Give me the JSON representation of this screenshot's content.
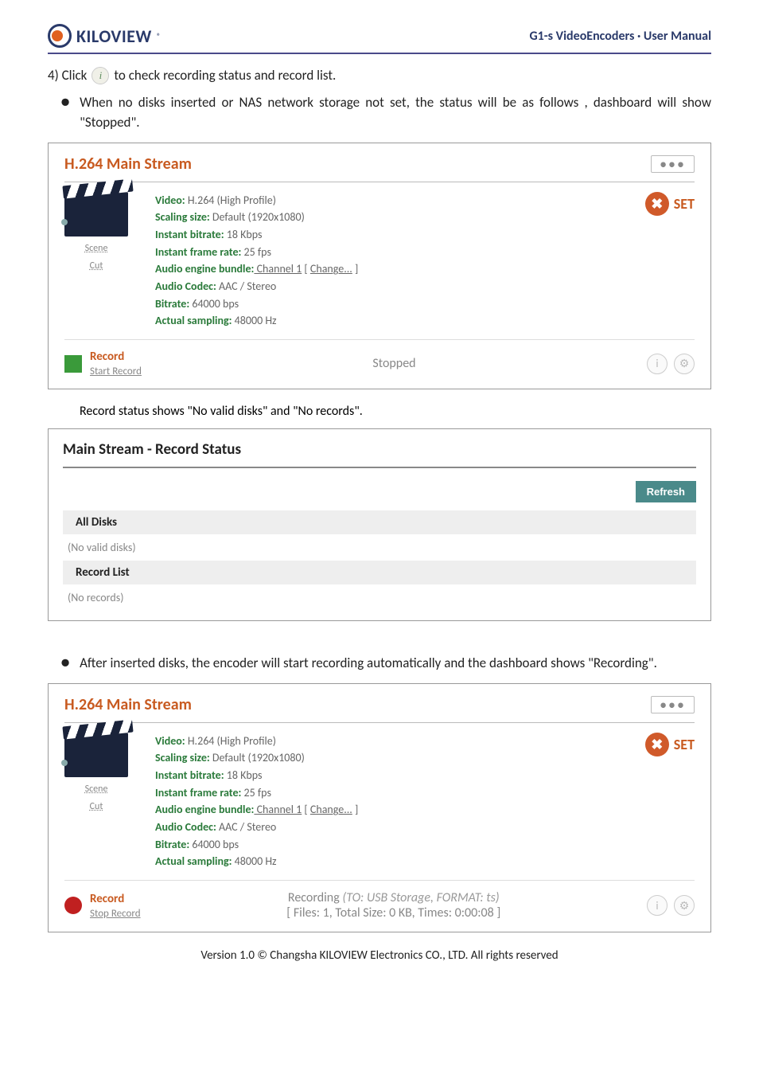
{
  "header": {
    "brand": "KILOVIEW",
    "reg": "®",
    "right": "G1-s VideoEncoders · User Manual"
  },
  "intro": {
    "click_prefix": "4) Click",
    "click_suffix": "to check recording status and record list.",
    "bullet1": "When no disks inserted or NAS network storage not set, the status will be as follows , dashboard will show \"Stopped\"."
  },
  "panel1": {
    "title": "H.264 Main Stream",
    "set": "SET",
    "scene": "Scene",
    "cut": "Cut",
    "info": {
      "video_k": "Video:",
      "video_v": " H.264 (High Profile)",
      "scale_k": "Scaling size:",
      "scale_v": " Default (1920x1080)",
      "ib_k": "Instant bitrate:",
      "ib_v": " 18 Kbps",
      "ifr_k": "Instant frame rate:",
      "ifr_v": " 25 fps",
      "aeb_k": "Audio engine bundle:",
      "aeb_v1": " Channel 1",
      "aeb_v2": " [ ",
      "aeb_link": "Change...",
      "aeb_v3": " ]",
      "ac_k": "Audio Codec:",
      "ac_v": " AAC / Stereo",
      "br_k": "Bitrate:",
      "br_v": " 64000 bps",
      "as_k": "Actual sampling:",
      "as_v": " 48000 Hz"
    },
    "rec": {
      "title": "Record",
      "link": "Start Record",
      "status": "Stopped"
    }
  },
  "caption1": "Record status shows \"No valid disks\" and \"No records\".",
  "status_panel": {
    "title": "Main Stream - Record Status",
    "refresh": "Refresh",
    "all_disks": "All Disks",
    "no_disks": "(No valid disks)",
    "record_list": "Record List",
    "no_records": "(No records)"
  },
  "bullet2": "After inserted disks, the encoder will start recording automatically and the dashboard shows \"Recording\".",
  "panel2": {
    "title": "H.264 Main Stream",
    "set": "SET",
    "scene": "Scene",
    "cut": "Cut",
    "rec": {
      "title": "Record",
      "link": "Stop Record",
      "line1": "Recording ",
      "line1_em": "(TO: USB Storage, FORMAT: ts)",
      "line2": "[ Files: 1, Total Size: 0 KB, Times: 0:00:08 ]"
    }
  },
  "footer": "Version 1.0 © Changsha KILOVIEW Electronics CO., LTD. All rights reserved"
}
